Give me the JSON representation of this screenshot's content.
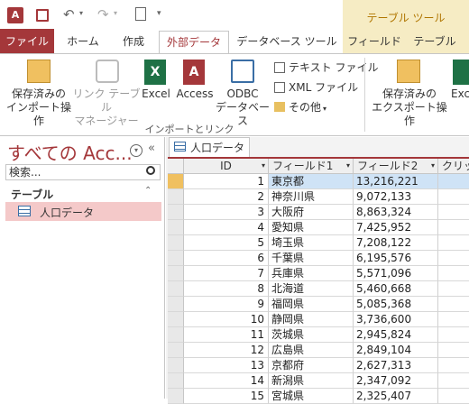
{
  "quick_access": {
    "app_icon": "access-app-icon",
    "save_icon": "save-icon",
    "undo_icon": "undo-icon",
    "redo_icon": "redo-icon",
    "preview_icon": "print-preview-icon"
  },
  "context_tab_group": "テーブル ツール",
  "tabs": [
    "ファイル",
    "ホーム",
    "作成",
    "外部データ",
    "データベース ツール",
    "フィールド",
    "テーブル"
  ],
  "ribbon": {
    "saved_imports": [
      "保存済みの",
      "インポート操作"
    ],
    "linked_table_manager": [
      "リンク テーブル",
      "マネージャー"
    ],
    "excel": "Excel",
    "access": "Access",
    "odbc": [
      "ODBC",
      "データベース"
    ],
    "text_file": "テキスト ファイル",
    "xml_file": "XML ファイル",
    "more": "その他",
    "group_label": "インポートとリンク",
    "saved_exports": [
      "保存済みの",
      "エクスポート操作"
    ],
    "excel_export": "Exc"
  },
  "nav": {
    "title": "すべての Acc...",
    "search_placeholder": "検索...",
    "section": "テーブル",
    "item": "人口データ"
  },
  "document_tab": "人口データ",
  "grid": {
    "columns": [
      "ID",
      "フィールド1",
      "フィールド2",
      "クリック"
    ],
    "rows": [
      [
        "1",
        "東京都",
        "13,216,221"
      ],
      [
        "2",
        "神奈川県",
        "9,072,133"
      ],
      [
        "3",
        "大阪府",
        "8,863,324"
      ],
      [
        "4",
        "愛知県",
        "7,425,952"
      ],
      [
        "5",
        "埼玉県",
        "7,208,122"
      ],
      [
        "6",
        "千葉県",
        "6,195,576"
      ],
      [
        "7",
        "兵庫県",
        "5,571,096"
      ],
      [
        "8",
        "北海道",
        "5,460,668"
      ],
      [
        "9",
        "福岡県",
        "5,085,368"
      ],
      [
        "10",
        "静岡県",
        "3,736,600"
      ],
      [
        "11",
        "茨城県",
        "2,945,824"
      ],
      [
        "12",
        "広島県",
        "2,849,104"
      ],
      [
        "13",
        "京都府",
        "2,627,313"
      ],
      [
        "14",
        "新潟県",
        "2,347,092"
      ],
      [
        "15",
        "宮城県",
        "2,325,407"
      ]
    ]
  },
  "colors": {
    "accent": "#a4373a",
    "context_tab": "#f6ecc4",
    "selected_row": "#cfe3f6",
    "nav_selected": "#f4c9c9"
  }
}
